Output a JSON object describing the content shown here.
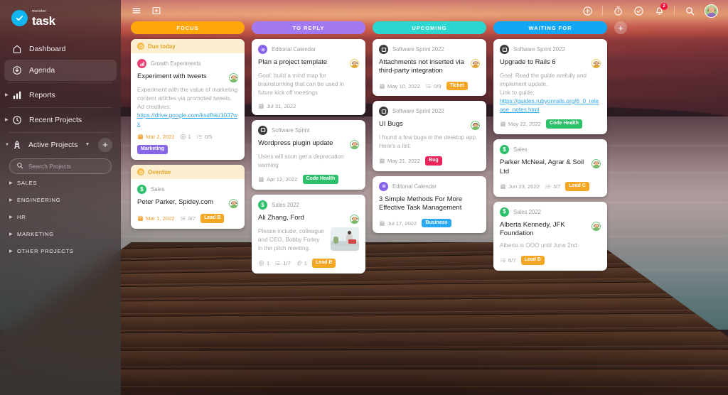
{
  "app": {
    "brand_small": "meister",
    "brand_name": "task"
  },
  "sidebar": {
    "nav": [
      {
        "label": "Dashboard",
        "icon": "home-icon",
        "active": false,
        "caret": false
      },
      {
        "label": "Agenda",
        "icon": "agenda-icon",
        "active": true,
        "caret": false
      },
      {
        "label": "Reports",
        "icon": "bar-chart-icon",
        "active": false,
        "caret": true
      },
      {
        "label": "Recent Projects",
        "icon": "clock-icon",
        "active": false,
        "caret": true
      }
    ],
    "projects_header": {
      "label": "Active Projects",
      "icon": "rocket-icon",
      "add_label": "+"
    },
    "search": {
      "placeholder": "Search Projects",
      "value": ""
    },
    "categories": [
      "SALES",
      "ENGINEERING",
      "HR",
      "MARKETING",
      "OTHER PROJECTS"
    ]
  },
  "topbar": {
    "left_icons": [
      "hamburger-menu-icon",
      "add-board-icon"
    ],
    "right_icons": [
      "plus-circle-icon",
      "timer-icon",
      "check-circle-icon",
      "bell-icon",
      "search-icon"
    ],
    "notification_count": "2"
  },
  "board": {
    "add_column_label": "+",
    "columns": [
      {
        "name": "FOCUS",
        "color": "#FFA60A",
        "cards": [
          {
            "banner": "Due today",
            "banner_bg": "#FCEFD1",
            "banner_color": "#E3A326",
            "project": "Growth Experiments",
            "project_color": "#EE3D72",
            "project_icon": "chart-icon",
            "title": "Experiment with tweets",
            "avatar": "green",
            "desc": "Experiment with the value of marketing content articles via promoted tweets.",
            "desc2": "Ad creatives:",
            "link": "https://drive.google.com/ksdfhki/1037wx",
            "meta": [
              {
                "icon": "calendar-icon",
                "text": "Mar 2, 2022",
                "due": true
              },
              {
                "icon": "comment-icon",
                "text": "1",
                "due": false
              },
              {
                "icon": "checklist-icon",
                "text": "0/5",
                "due": false
              }
            ],
            "tags": [
              {
                "text": "Marketing",
                "color": "#8764E8"
              }
            ]
          },
          {
            "banner": "Overdue",
            "banner_bg": "#FCEFD1",
            "banner_color": "#E3A326",
            "project": "Sales",
            "project_color": "#2CC06B",
            "project_icon": "dollar-icon",
            "title": "Peter Parker, Spidey.com",
            "avatar": "green",
            "desc": "",
            "desc2": "",
            "link": "",
            "meta": [
              {
                "icon": "calendar-icon",
                "text": "Mar 1, 2022",
                "due": true
              },
              {
                "icon": "checklist-icon",
                "text": "3/7",
                "due": false
              }
            ],
            "inline_tags": [
              {
                "text": "Lead B",
                "color": "#F5A623"
              }
            ],
            "tags": []
          }
        ]
      },
      {
        "name": "TO REPLY",
        "color": "#A279F0",
        "cards": [
          {
            "banner": "",
            "project": "Editorial Calendar",
            "project_color": "#8764E8",
            "project_icon": "flower-icon",
            "title": "Plan a project template",
            "avatar": "yellow",
            "desc": "Goal: build a mind map for brainstorming that can be used in future kick off meetings",
            "desc2": "",
            "link": "",
            "meta": [
              {
                "icon": "calendar-icon",
                "text": "Jul 31, 2022",
                "due": false
              }
            ],
            "tags": []
          },
          {
            "banner": "",
            "project": "Software Sprint",
            "project_color": "#3D3D3D",
            "project_icon": "monitor-icon",
            "title": "Wordpress plugin update",
            "avatar": "green",
            "desc": "Users will soon get a deprecation warning",
            "desc2": "",
            "link": "",
            "meta": [
              {
                "icon": "calendar-icon",
                "text": "Apr 12, 2022",
                "due": false
              }
            ],
            "inline_tags": [
              {
                "text": "Code Health",
                "color": "#2CC06B"
              }
            ],
            "tags": []
          },
          {
            "banner": "",
            "project": "Sales 2022",
            "project_color": "#2CC06B",
            "project_icon": "dollar-icon",
            "title": "Ali Zhang, Ford",
            "avatar": "green",
            "desc": "Please include, colleague and CEO, Bobby Forley in the pitch meeting.",
            "desc2": "",
            "link": "",
            "thumbnail": "meeting-photo",
            "meta": [
              {
                "icon": "comment-icon",
                "text": "1",
                "due": false
              },
              {
                "icon": "checklist-icon",
                "text": "1/7",
                "due": false
              },
              {
                "icon": "attachment-icon",
                "text": "1",
                "due": false
              }
            ],
            "inline_tags": [
              {
                "text": "Lead B",
                "color": "#F5A623"
              }
            ],
            "tags": []
          }
        ]
      },
      {
        "name": "UPCOMING",
        "color": "#2BD6CE",
        "cards": [
          {
            "banner": "",
            "project": "Software Sprint 2022",
            "project_color": "#3D3D3D",
            "project_icon": "monitor-icon",
            "title": "Attachments not inserted via third-party integration",
            "avatar": "yellow",
            "desc": "",
            "desc2": "",
            "link": "",
            "meta": [
              {
                "icon": "calendar-icon",
                "text": "May 10, 2022",
                "due": false
              },
              {
                "icon": "checklist-icon",
                "text": "0/9",
                "due": false
              }
            ],
            "inline_tags": [
              {
                "text": "Ticket",
                "color": "#F5A623"
              }
            ],
            "tags": []
          },
          {
            "banner": "",
            "project": "Software Sprint 2022",
            "project_color": "#3D3D3D",
            "project_icon": "monitor-icon",
            "title": "UI Bugs",
            "avatar": "green",
            "desc": "I found a few bugs in the desktop app. Here's a list:",
            "desc2": "",
            "link": "",
            "meta": [
              {
                "icon": "calendar-icon",
                "text": "May 21, 2022",
                "due": false
              }
            ],
            "inline_tags": [
              {
                "text": "Bug",
                "color": "#E8245A"
              }
            ],
            "tags": []
          },
          {
            "banner": "",
            "project": "Editorial Calendar",
            "project_color": "#8764E8",
            "project_icon": "flower-icon",
            "title": "3 Simple Methods For More Effective Task Management",
            "avatar": "none",
            "desc": "",
            "desc2": "",
            "link": "",
            "meta": [
              {
                "icon": "calendar-icon",
                "text": "Jul 17, 2022",
                "due": false
              }
            ],
            "inline_tags": [
              {
                "text": "Business",
                "color": "#2AA8F2"
              }
            ],
            "tags": []
          }
        ]
      },
      {
        "name": "WAITING FOR",
        "color": "#11A7F5",
        "cards": [
          {
            "banner": "",
            "project": "Software Sprint 2022",
            "project_color": "#3D3D3D",
            "project_icon": "monitor-icon",
            "title": "Upgrade to Rails 6",
            "avatar": "yellow",
            "desc": "Goal: Read the guide arefully and implement update.",
            "desc2": "Link to guide:",
            "link": "https://guides.rubyonrails.org/6_0_release_notes.html",
            "meta": [
              {
                "icon": "calendar-icon",
                "text": "May 22, 2022",
                "due": false
              }
            ],
            "inline_tags": [
              {
                "text": "Code Health",
                "color": "#2CC06B"
              }
            ],
            "tags": []
          },
          {
            "banner": "",
            "project": "Sales",
            "project_color": "#2CC06B",
            "project_icon": "dollar-icon",
            "title": "Parker McNeal, Agrar & Soil Ltd",
            "avatar": "green",
            "desc": "",
            "desc2": "",
            "link": "",
            "meta": [
              {
                "icon": "calendar-icon",
                "text": "Jun 23, 2022",
                "due": false
              },
              {
                "icon": "checklist-icon",
                "text": "3/7",
                "due": false
              }
            ],
            "inline_tags": [
              {
                "text": "Lead C",
                "color": "#F5A623"
              }
            ],
            "tags": []
          },
          {
            "banner": "",
            "project": "Sales 2022",
            "project_color": "#2CC06B",
            "project_icon": "dollar-icon",
            "title": "Alberta Kennedy, JFK Foundation",
            "avatar": "green",
            "desc": "Alberta is OOO until June 2nd.",
            "desc2": "",
            "link": "",
            "meta": [
              {
                "icon": "checklist-icon",
                "text": "6/7",
                "due": false
              }
            ],
            "inline_tags": [
              {
                "text": "Lead B",
                "color": "#F5A623"
              }
            ],
            "tags": []
          }
        ]
      }
    ]
  }
}
